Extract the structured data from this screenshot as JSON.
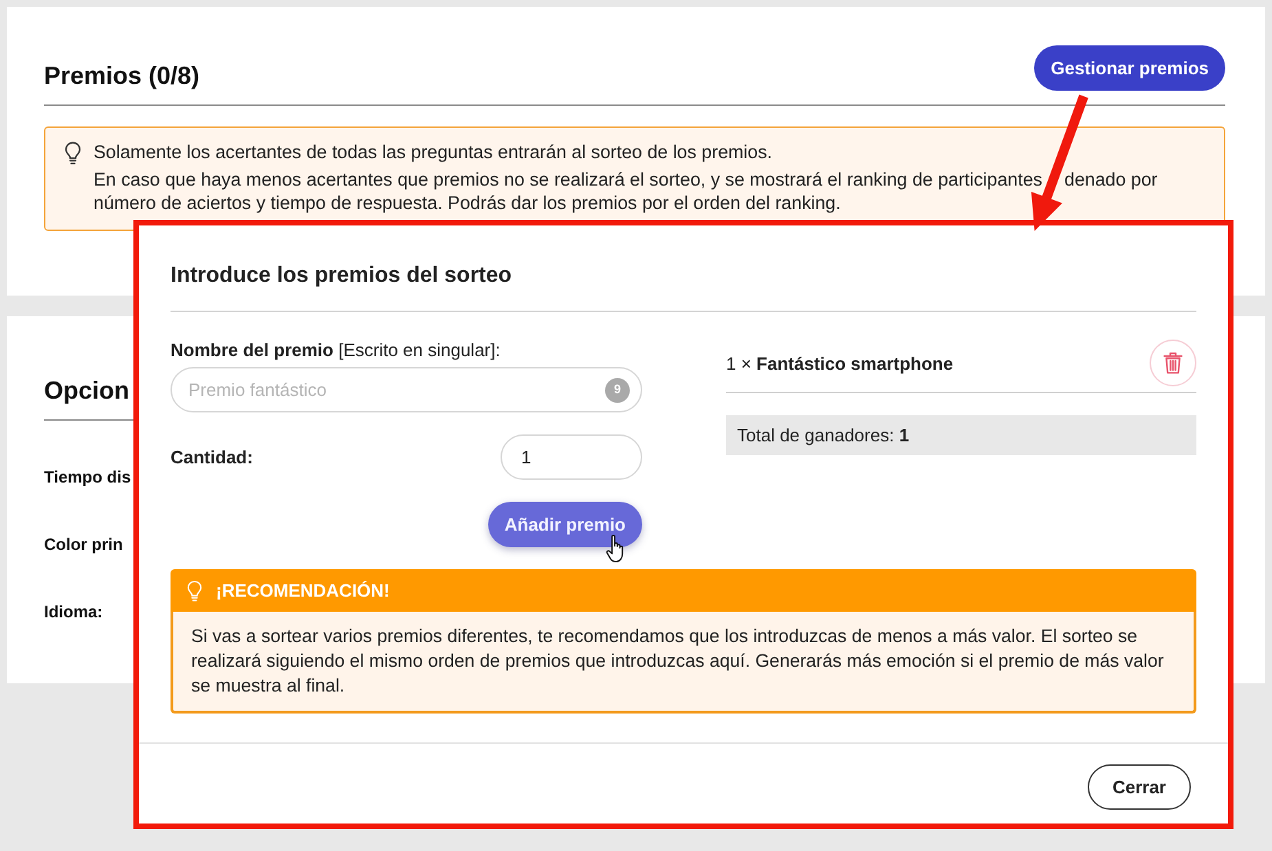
{
  "prizes_section": {
    "title": "Premios (0/8)",
    "manage_button": "Gestionar premios",
    "notice": {
      "paragraphs": [
        [
          [
            "Solamente los acertantes de todas las preguntas entrarán al sorteo de los premios."
          ]
        ],
        [
          [
            "En caso que haya menos acertantes que premios no se realizará el sorteo, y se mostrará el ranking de participantes",
            "denado por"
          ],
          [
            "número de aciertos y tiempo de respuesta. Podrás dar los premios por el orden del ranking."
          ]
        ]
      ]
    }
  },
  "options_section": {
    "title": "Opcion",
    "fields": [
      "Tiempo dis",
      "Color prin",
      "Idioma:"
    ]
  },
  "dialog": {
    "title": "Introduce los premios del sorteo",
    "name_field": {
      "label": "**Nombre del premio** [Escrito en singular]:",
      "placeholder": "Premio fantástico",
      "counter": "9"
    },
    "quantity_field": {
      "label": "Cantidad:",
      "value": "1"
    },
    "add_button": "Añadir premio",
    "prizes": [
      {
        "text": "1 × **Fantástico smartphone**"
      }
    ],
    "total": "Total de ganadores: **1**",
    "recommendation": {
      "title": "¡RECOMENDACIÓN!",
      "text": "Si vas a sortear varios premios diferentes, te recomendamos que los introduzcas de menos a más valor. El sorteo se realizará siguiendo el mismo orden de premios que introduzcas aquí. Generarás más emoción si el premio de más valor se muestra al final."
    },
    "close_button": "Cerrar"
  }
}
